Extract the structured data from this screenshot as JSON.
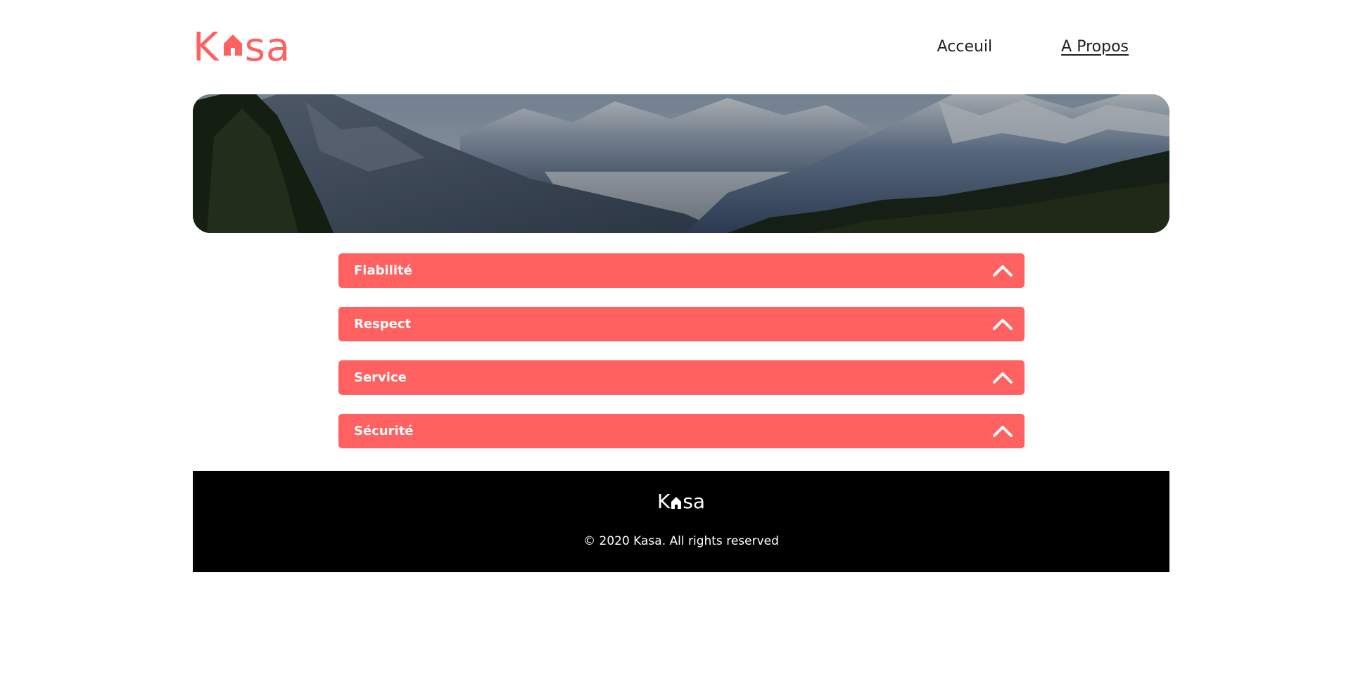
{
  "brand": {
    "logo_left": "K",
    "logo_right": "sa",
    "logo_alt": "Kasa",
    "accent_color": "#ff6060"
  },
  "nav": {
    "items": [
      {
        "label": "Acceuil",
        "active": false
      },
      {
        "label": "A Propos",
        "active": true
      }
    ]
  },
  "banner": {
    "image": "mountain-valley-landscape"
  },
  "collapses": [
    {
      "title": "Fiabilité",
      "icon": "chevron-up-icon"
    },
    {
      "title": "Respect",
      "icon": "chevron-up-icon"
    },
    {
      "title": "Service",
      "icon": "chevron-up-icon"
    },
    {
      "title": "Sécurité",
      "icon": "chevron-up-icon"
    }
  ],
  "footer": {
    "logo_left": "K",
    "logo_right": "sa",
    "copyright": "© 2020 Kasa. All rights reserved",
    "background": "#000000"
  }
}
